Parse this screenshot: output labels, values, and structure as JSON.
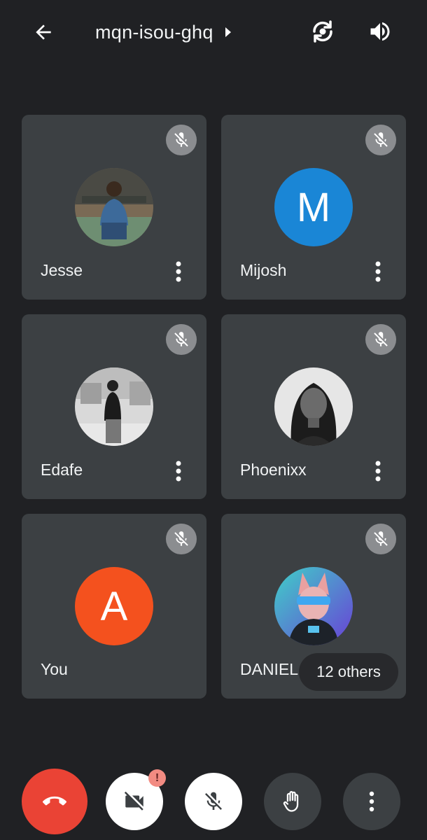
{
  "header": {
    "meeting_code": "mqn-isou-ghq"
  },
  "participants": [
    {
      "name": "Jesse",
      "avatar_type": "photo"
    },
    {
      "name": "Mijosh",
      "avatar_type": "letter",
      "initial": "M",
      "color": "#1a86d6"
    },
    {
      "name": "Edafe",
      "avatar_type": "photo"
    },
    {
      "name": "Phoenixx",
      "avatar_type": "photo"
    },
    {
      "name": "You",
      "avatar_type": "letter",
      "initial": "A",
      "color": "#f4511e"
    },
    {
      "name": "DANIEL",
      "avatar_type": "photo"
    }
  ],
  "others_label": "12 others",
  "controls": {
    "camera_alert": "!"
  },
  "colors": {
    "background": "#202124",
    "tile": "#3c4043",
    "end_call": "#ea4335",
    "mute_badge": "#8b8d90"
  }
}
